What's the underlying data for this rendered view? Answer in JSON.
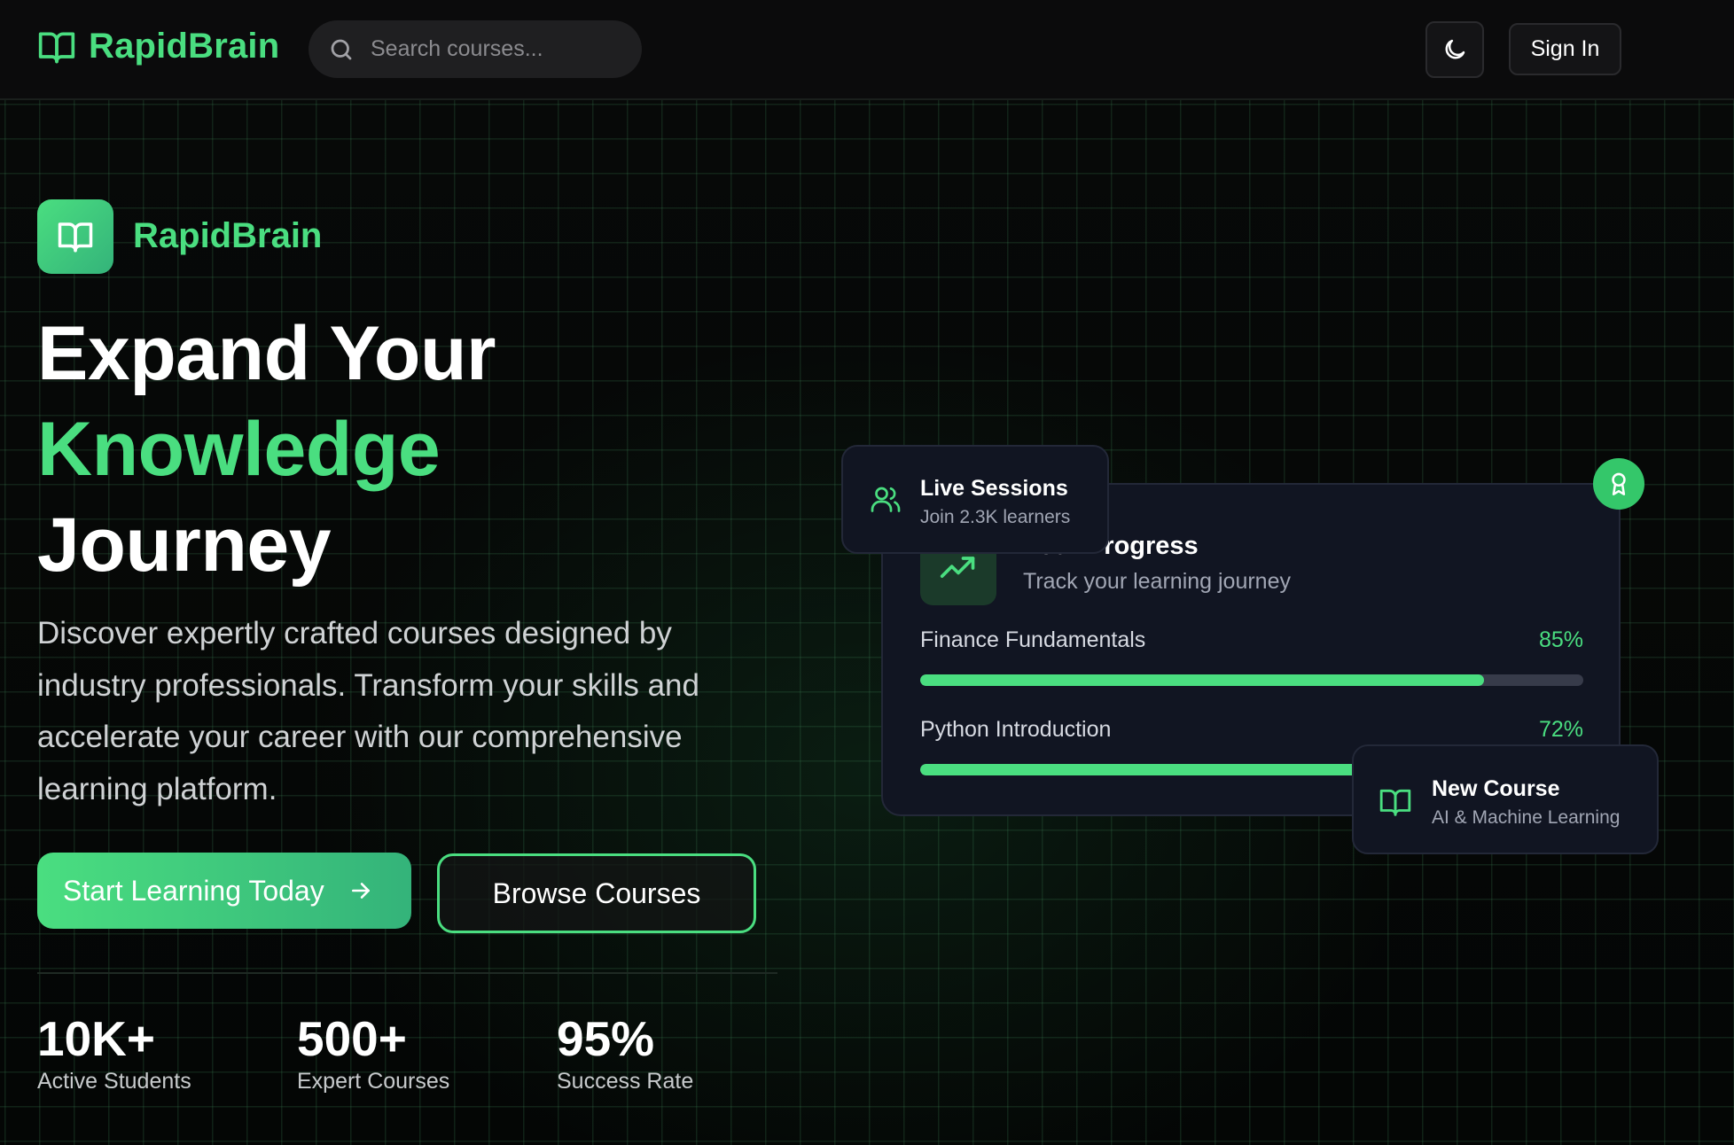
{
  "header": {
    "brand_name": "RapidBrain",
    "brand_icon": "book-open-icon",
    "search_placeholder": "Search courses...",
    "search_icon": "search-icon",
    "theme_toggle_icon": "moon-icon",
    "sign_in_label": "Sign In"
  },
  "hero": {
    "logo_icon": "book-open-icon",
    "logo_text": "RapidBrain",
    "headline": {
      "line1": "Expand Your",
      "line2": "Knowledge",
      "line3": "Journey"
    },
    "description": "Discover expertly crafted courses designed by industry professionals. Transform your skills and accelerate your career with our comprehensive learning platform.",
    "primary_cta": "Start Learning Today",
    "primary_cta_icon": "arrow-right-icon",
    "secondary_cta": "Browse Courses",
    "stats": [
      {
        "value": "10K+",
        "label": "Active Students"
      },
      {
        "value": "500+",
        "label": "Expert Courses"
      },
      {
        "value": "95%",
        "label": "Success Rate"
      }
    ]
  },
  "progress_card": {
    "icon": "trending-up-icon",
    "title": "Your Progress",
    "subtitle": "Track your learning journey",
    "courses": [
      {
        "name": "Finance Fundamentals",
        "percent_label": "85%",
        "progress": 0.85
      },
      {
        "name": "Python Introduction",
        "percent_label": "72%",
        "progress": 0.72
      }
    ],
    "badge_icon": "award-icon"
  },
  "live_sessions": {
    "icon": "users-icon",
    "title": "Live Sessions",
    "subtitle": "Join 2.3K learners"
  },
  "new_course": {
    "icon": "book-open-icon",
    "title": "New Course",
    "subtitle": "AI & Machine Learning"
  },
  "colors": {
    "accent": "#4ade80",
    "accent_dark": "#34b37a",
    "background": "#060707",
    "card": "#111522"
  }
}
